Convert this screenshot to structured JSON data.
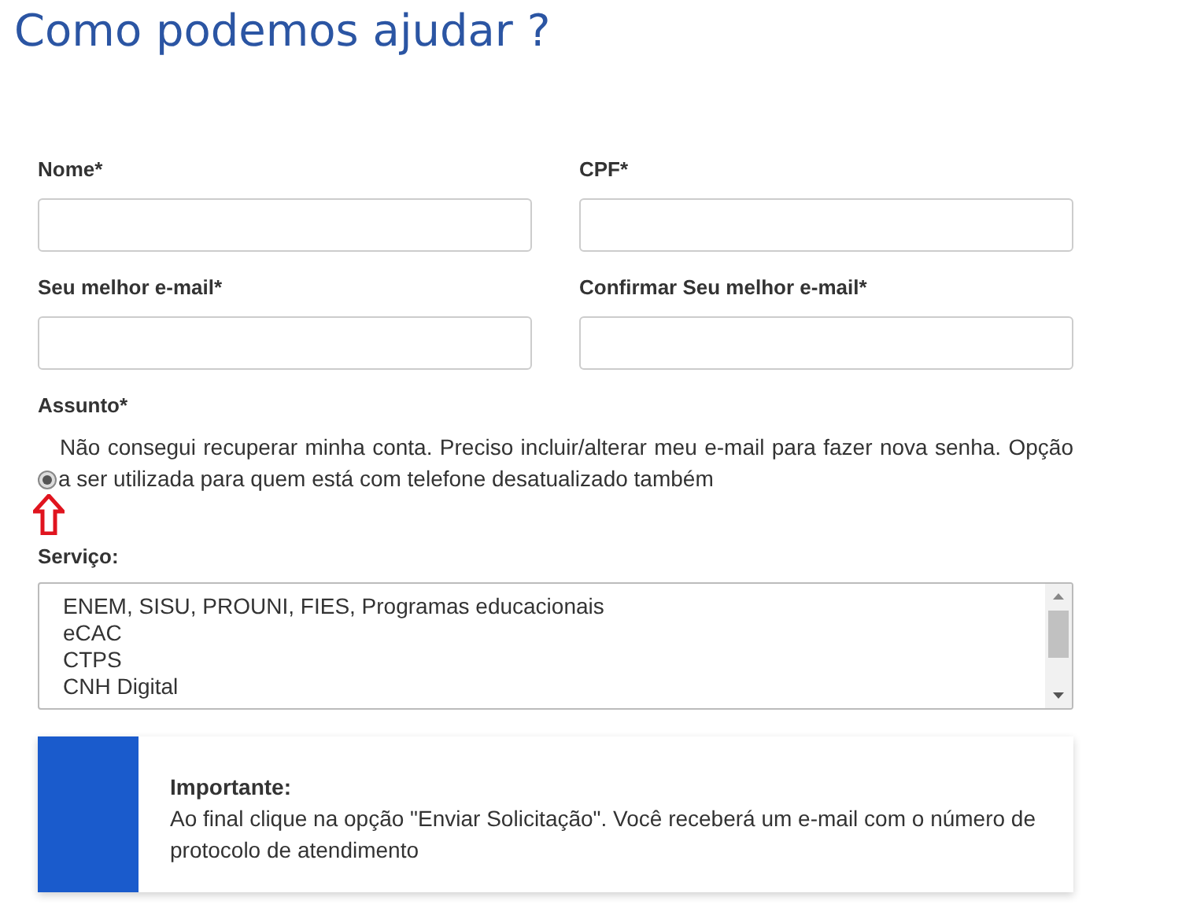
{
  "title": "Como podemos ajudar ?",
  "fields": [
    {
      "label": "Nome*"
    },
    {
      "label": "CPF*"
    },
    {
      "label": "Seu melhor e-mail*"
    },
    {
      "label": "Confirmar Seu melhor e-mail*"
    }
  ],
  "subject": {
    "label": "Assunto*",
    "options": [
      {
        "text": "Não consegui recuperar minha conta. Preciso incluir/alterar meu e-mail para fazer nova senha. Opção a ser utilizada para quem está com telefone desatualizado também",
        "selected": true
      }
    ]
  },
  "service": {
    "label": "Serviço:",
    "items": [
      "ENEM, SISU, PROUNI, FIES, Programas educacionais",
      "eCAC",
      "CTPS",
      "CNH Digital"
    ]
  },
  "notice": {
    "title": "Importante:",
    "text": "Ao final clique na opção \"Enviar Solicitação\". Você receberá um e-mail com o número de protocolo de atendimento"
  }
}
